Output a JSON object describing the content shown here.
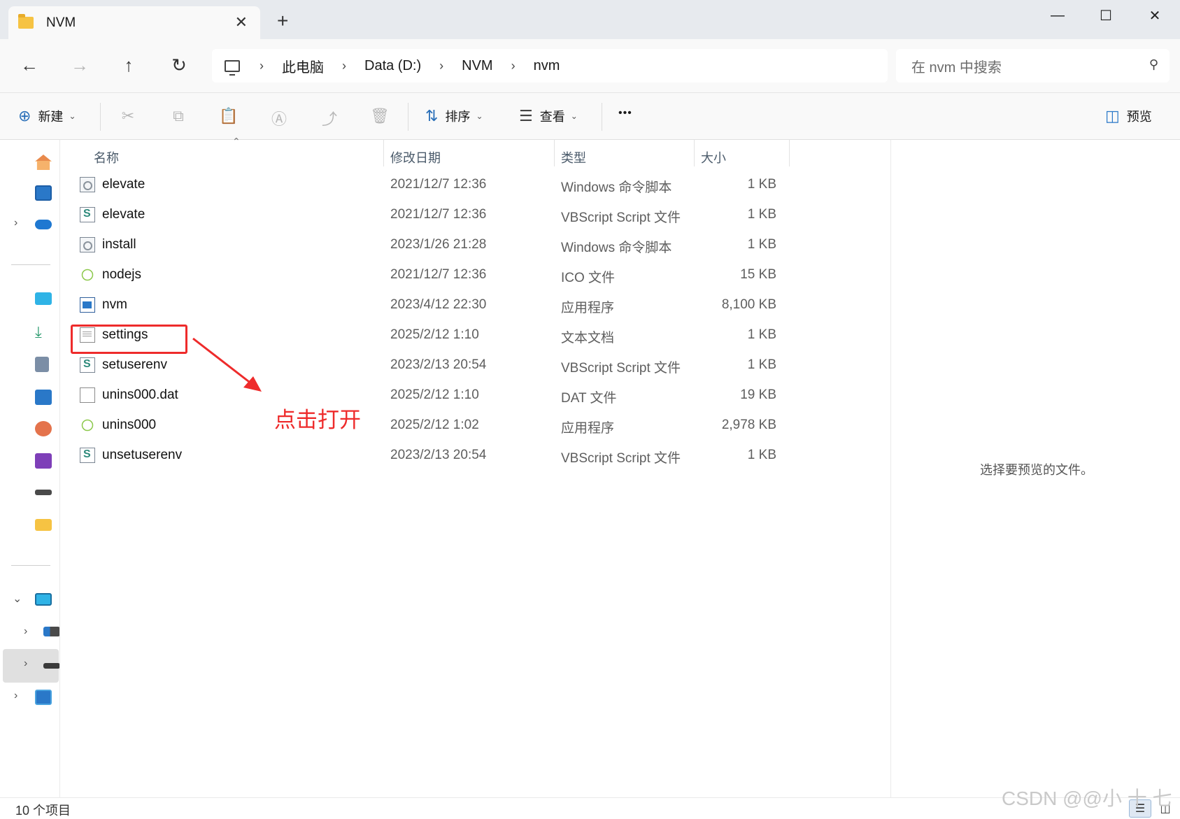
{
  "tab": {
    "title": "NVM",
    "close": "✕",
    "new_tab": "+"
  },
  "window_controls": {
    "minimize": "—",
    "maximize": "☐",
    "close": "✕"
  },
  "nav": {
    "back": "←",
    "forward": "→",
    "up": "↑",
    "refresh": "↻"
  },
  "address": {
    "crumbs": [
      "此电脑",
      "Data (D:)",
      "NVM",
      "nvm"
    ],
    "separator": "›"
  },
  "search": {
    "placeholder": "在 nvm 中搜索",
    "icon": "⚲"
  },
  "commandbar": {
    "new_label": "新建",
    "sort_label": "排序",
    "view_label": "查看",
    "more_label": "•••",
    "preview_label": "预览"
  },
  "columns": {
    "name": "名称",
    "date": "修改日期",
    "type": "类型",
    "size": "大小"
  },
  "files": [
    {
      "name": "elevate",
      "date": "2021/12/7 12:36",
      "type": "Windows 命令脚本",
      "size": "1 KB",
      "icon": "cmd-script-icon"
    },
    {
      "name": "elevate",
      "date": "2021/12/7 12:36",
      "type": "VBScript Script 文件",
      "size": "1 KB",
      "icon": "vbscript-icon"
    },
    {
      "name": "install",
      "date": "2023/1/26 21:28",
      "type": "Windows 命令脚本",
      "size": "1 KB",
      "icon": "cmd-script-icon"
    },
    {
      "name": "nodejs",
      "date": "2021/12/7 12:36",
      "type": "ICO 文件",
      "size": "15 KB",
      "icon": "nodejs-icon"
    },
    {
      "name": "nvm",
      "date": "2023/4/12 22:30",
      "type": "应用程序",
      "size": "8,100 KB",
      "icon": "application-icon"
    },
    {
      "name": "settings",
      "date": "2025/2/12 1:10",
      "type": "文本文档",
      "size": "1 KB",
      "icon": "text-document-icon"
    },
    {
      "name": "setuserenv",
      "date": "2023/2/13 20:54",
      "type": "VBScript Script 文件",
      "size": "1 KB",
      "icon": "vbscript-icon"
    },
    {
      "name": "unins000.dat",
      "date": "2025/2/12 1:10",
      "type": "DAT 文件",
      "size": "19 KB",
      "icon": "dat-file-icon"
    },
    {
      "name": "unins000",
      "date": "2025/2/12 1:02",
      "type": "应用程序",
      "size": "2,978 KB",
      "icon": "nodejs-icon"
    },
    {
      "name": "unsetuserenv",
      "date": "2023/2/13 20:54",
      "type": "VBScript Script 文件",
      "size": "1 KB",
      "icon": "vbscript-icon"
    }
  ],
  "annotation": {
    "text": "点击打开",
    "color": "#ee2b2b"
  },
  "preview": {
    "message": "选择要预览的文件。"
  },
  "status": {
    "item_count": "10 个项目"
  },
  "watermark": "CSDN @@小 十 七",
  "colors": {
    "accent": "#2a78c8",
    "annotation": "#ee2b2b",
    "selection": "#e0e0e0"
  }
}
